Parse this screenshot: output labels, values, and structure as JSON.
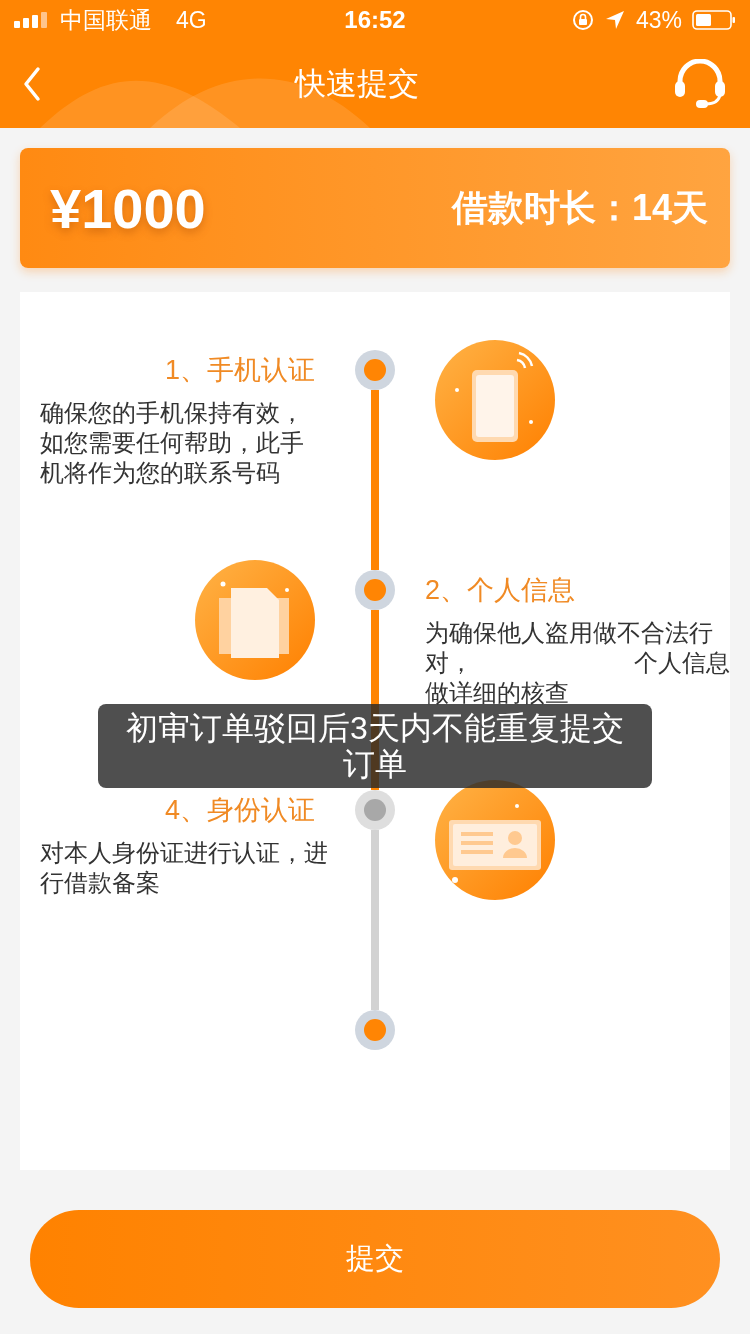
{
  "status_bar": {
    "carrier": "中国联通",
    "network": "4G",
    "time": "16:52",
    "battery": "43%"
  },
  "header": {
    "title": "快速提交"
  },
  "loan": {
    "amount": "¥1000",
    "term": "借款时长：14天"
  },
  "steps": [
    {
      "title": "1、手机认证",
      "kind": "phone",
      "completed": true,
      "lines": [
        [
          "确保您的手机保持有效，"
        ],
        [
          "如您需要任何帮助，此手"
        ],
        [
          "机将作为您的联系号码"
        ]
      ]
    },
    {
      "title": "2、个人信息",
      "kind": "documents",
      "completed": true,
      "lines": [
        [
          "为确保他人盗用做不合法行"
        ],
        [
          "对，",
          "个人信息"
        ],
        [
          "做详细的核查"
        ]
      ]
    },
    {
      "title": "4、身份认证",
      "kind": "id-card",
      "completed": false,
      "lines": [
        [
          "对本人身份证进行认证，进"
        ],
        [
          "行借款备案"
        ]
      ]
    }
  ],
  "end_node": {
    "completed": true
  },
  "toast": {
    "text": "初审订单驳回后3天内不能重复提交订单"
  },
  "submit_button": {
    "label": "提交"
  }
}
